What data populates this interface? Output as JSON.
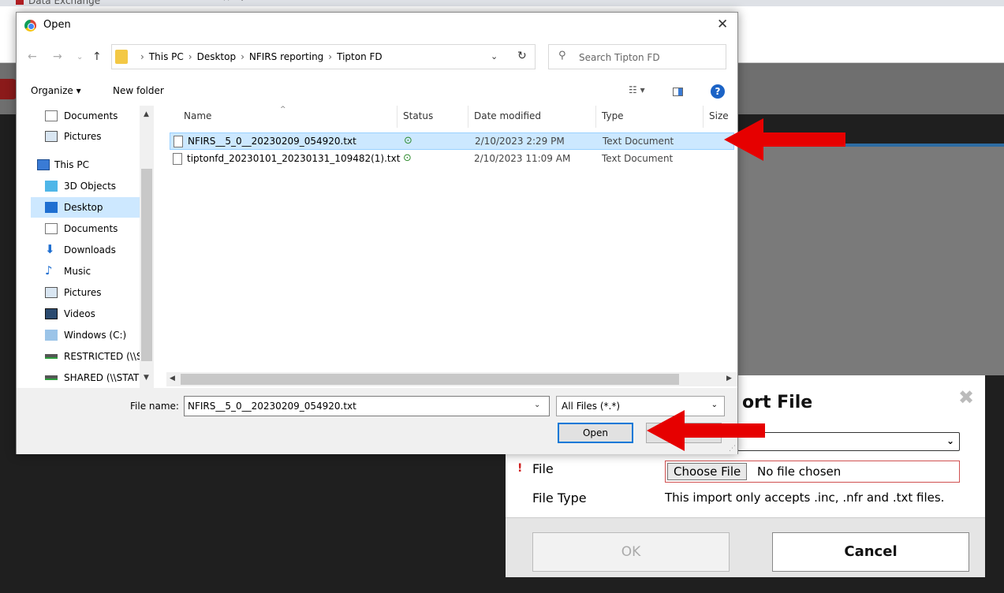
{
  "browser": {
    "tab_title": "Data Exchange",
    "tab_close": "×",
    "new_tab": "+"
  },
  "import_modal": {
    "title": "ort File",
    "close_icon": "✖",
    "file_label": "File",
    "required_mark": "!",
    "choose_file_label": "Choose File",
    "no_file_text": "No file chosen",
    "file_type_label": "File Type",
    "file_type_value": "This import only accepts .inc, .nfr and .txt files.",
    "ok_label": "OK",
    "cancel_label": "Cancel"
  },
  "open_dialog": {
    "title": "Open",
    "close_icon": "✕",
    "breadcrumbs": [
      "This PC",
      "Desktop",
      "NFIRS reporting",
      "Tipton FD"
    ],
    "search_placeholder": "Search Tipton FD",
    "toolbar": {
      "organize_label": "Organize ▾",
      "new_folder_label": "New folder"
    },
    "nav_items": [
      {
        "label": "Documents",
        "icon": "document-icon"
      },
      {
        "label": "Pictures",
        "icon": "pictures-icon"
      },
      {
        "label": "This PC",
        "icon": "pc-icon"
      },
      {
        "label": "3D Objects",
        "icon": "cube-icon"
      },
      {
        "label": "Desktop",
        "icon": "desktop-icon"
      },
      {
        "label": "Documents",
        "icon": "document-icon"
      },
      {
        "label": "Downloads",
        "icon": "download-icon"
      },
      {
        "label": "Music",
        "icon": "music-icon"
      },
      {
        "label": "Pictures",
        "icon": "pictures-icon"
      },
      {
        "label": "Videos",
        "icon": "video-icon"
      },
      {
        "label": "Windows (C:)",
        "icon": "drive-icon"
      },
      {
        "label": "RESTRICTED (\\\\S",
        "icon": "network-drive-icon"
      },
      {
        "label": "SHARED (\\\\STAT",
        "icon": "network-drive-icon"
      }
    ],
    "columns": {
      "name": "Name",
      "status": "Status",
      "date_modified": "Date modified",
      "type": "Type",
      "size": "Size"
    },
    "files": [
      {
        "name": "NFIRS__5_0__20230209_054920.txt",
        "status": "⊙",
        "date": "2/10/2023 2:29 PM",
        "type": "Text Document",
        "selected": true
      },
      {
        "name": "tiptonfd_20230101_20230131_109482(1).txt",
        "status": "⊙",
        "date": "2/10/2023 11:09 AM",
        "type": "Text Document",
        "selected": false
      }
    ],
    "file_name_label": "File name:",
    "file_name_value": "NFIRS__5_0__20230209_054920.txt",
    "file_type_filter": "All Files (*.*)",
    "open_label": "Open"
  },
  "colors": {
    "arrow_red": "#e60000",
    "selection_blue": "#cce8ff",
    "accent_blue": "#0078d7"
  }
}
